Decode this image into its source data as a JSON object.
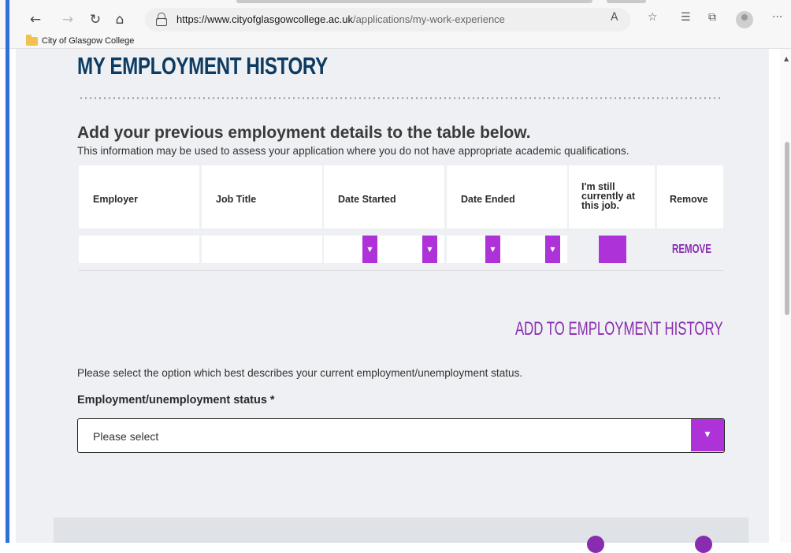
{
  "browser": {
    "url_host": "https://www.cityofglasgowcollege.ac.uk",
    "url_path": "/applications/my-work-experience",
    "bookmark": "City of Glasgow College",
    "menu": "···"
  },
  "page": {
    "title": "MY EMPLOYMENT HISTORY",
    "subtitle": "Add your previous employment details to the table below.",
    "description": "This information may be used to assess your application where you do not have appropriate academic qualifications.",
    "table": {
      "headers": [
        "Employer",
        "Job Title",
        "Date Started",
        "Date Ended",
        "I'm still currently at this job.",
        "Remove"
      ],
      "remove_label": "REMOVE"
    },
    "add_label": "ADD TO EMPLOYMENT HISTORY",
    "status_help": "Please select the option which best describes your current employment/unemployment status.",
    "status_label": "Employment/unemployment status *",
    "status_value": "Please select"
  },
  "colors": {
    "accent": "#ad33d9",
    "link": "#8a2cb0",
    "heading": "#0d3b62"
  }
}
